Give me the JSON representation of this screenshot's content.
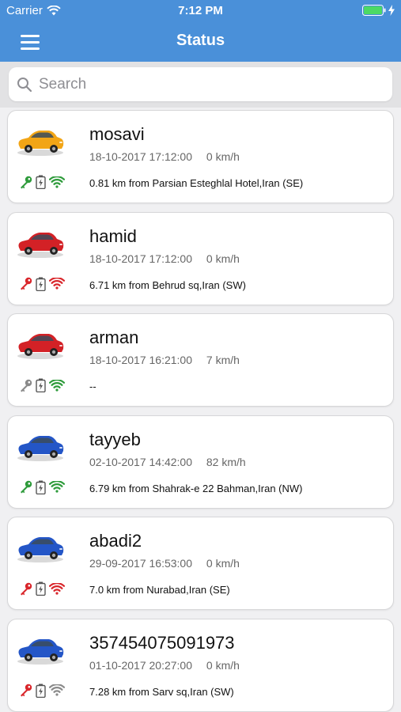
{
  "statusbar": {
    "carrier": "Carrier",
    "time": "7:12 PM"
  },
  "nav": {
    "title": "Status"
  },
  "search": {
    "placeholder": "Search"
  },
  "colors": {
    "green": "#2e9b3b",
    "red": "#d9262b",
    "gray": "#8a8a8a",
    "blue_bar": "#4a90d9"
  },
  "vehicles": [
    {
      "name": "mosavi",
      "date": "18-10-2017 17:12:00",
      "speed": "0 km/h",
      "address": "0.81 km from Parsian Esteghlal Hotel,Iran (SE)",
      "car_color": "#f2a516",
      "key": "green",
      "signal": "green"
    },
    {
      "name": "hamid",
      "date": "18-10-2017 17:12:00",
      "speed": "0 km/h",
      "address": "6.71 km from Behrud sq,Iran (SW)",
      "car_color": "#d32126",
      "key": "red",
      "signal": "red"
    },
    {
      "name": "arman",
      "date": "18-10-2017 16:21:00",
      "speed": "7 km/h",
      "address": "--",
      "car_color": "#d32126",
      "key": "gray",
      "signal": "green"
    },
    {
      "name": "tayyeb",
      "date": "02-10-2017 14:42:00",
      "speed": "82 km/h",
      "address": "6.79 km from Shahrak-e 22 Bahman,Iran (NW)",
      "car_color": "#2456c7",
      "key": "green",
      "signal": "green"
    },
    {
      "name": "abadi2",
      "date": "29-09-2017 16:53:00",
      "speed": "0 km/h",
      "address": "7.0 km from Nurabad,Iran (SE)",
      "car_color": "#2456c7",
      "key": "red",
      "signal": "red"
    },
    {
      "name": "357454075091973",
      "date": "01-10-2017 20:27:00",
      "speed": "0 km/h",
      "address": "7.28 km from Sarv sq,Iran (SW)",
      "car_color": "#2456c7",
      "key": "red",
      "signal": "gray"
    }
  ]
}
